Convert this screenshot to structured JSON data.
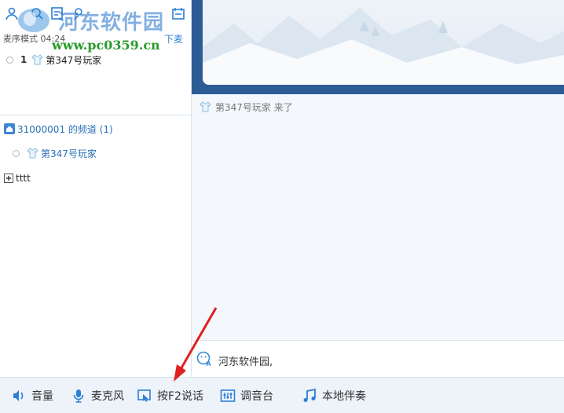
{
  "left_panel": {
    "mode_label": "麦序模式 04:24",
    "mic_down": "下麦",
    "mic_user": {
      "index": "1",
      "name": "第347号玩家"
    },
    "channel": {
      "name": "31000001 的频道 (1)"
    },
    "channel_user": {
      "name": "第347号玩家"
    },
    "sub_channel": {
      "name": "tttt"
    }
  },
  "watermark": {
    "title": "河东软件园",
    "url": "www.pc0359.cn"
  },
  "chat": {
    "join_message": "第347号玩家 来了",
    "input_text": "河东软件园,"
  },
  "toolbar": {
    "volume": "音量",
    "microphone": "麦克风",
    "push_to_talk": "按F2说话",
    "mixer": "调音台",
    "local_accompany": "本地伴奏"
  },
  "colors": {
    "accent": "#2e7fd6",
    "banner": "#2d5b96",
    "toolbar_bg": "#edf3f9",
    "annotation_arrow": "#e02020"
  },
  "icons": [
    "user-icon",
    "search-icon",
    "note-icon",
    "person-search-icon",
    "calendar-icon",
    "home-icon",
    "plus-icon",
    "shirt-icon",
    "emoji-icon",
    "speaker-icon",
    "microphone-icon",
    "push-talk-icon",
    "mixer-icon",
    "music-note-icon"
  ]
}
